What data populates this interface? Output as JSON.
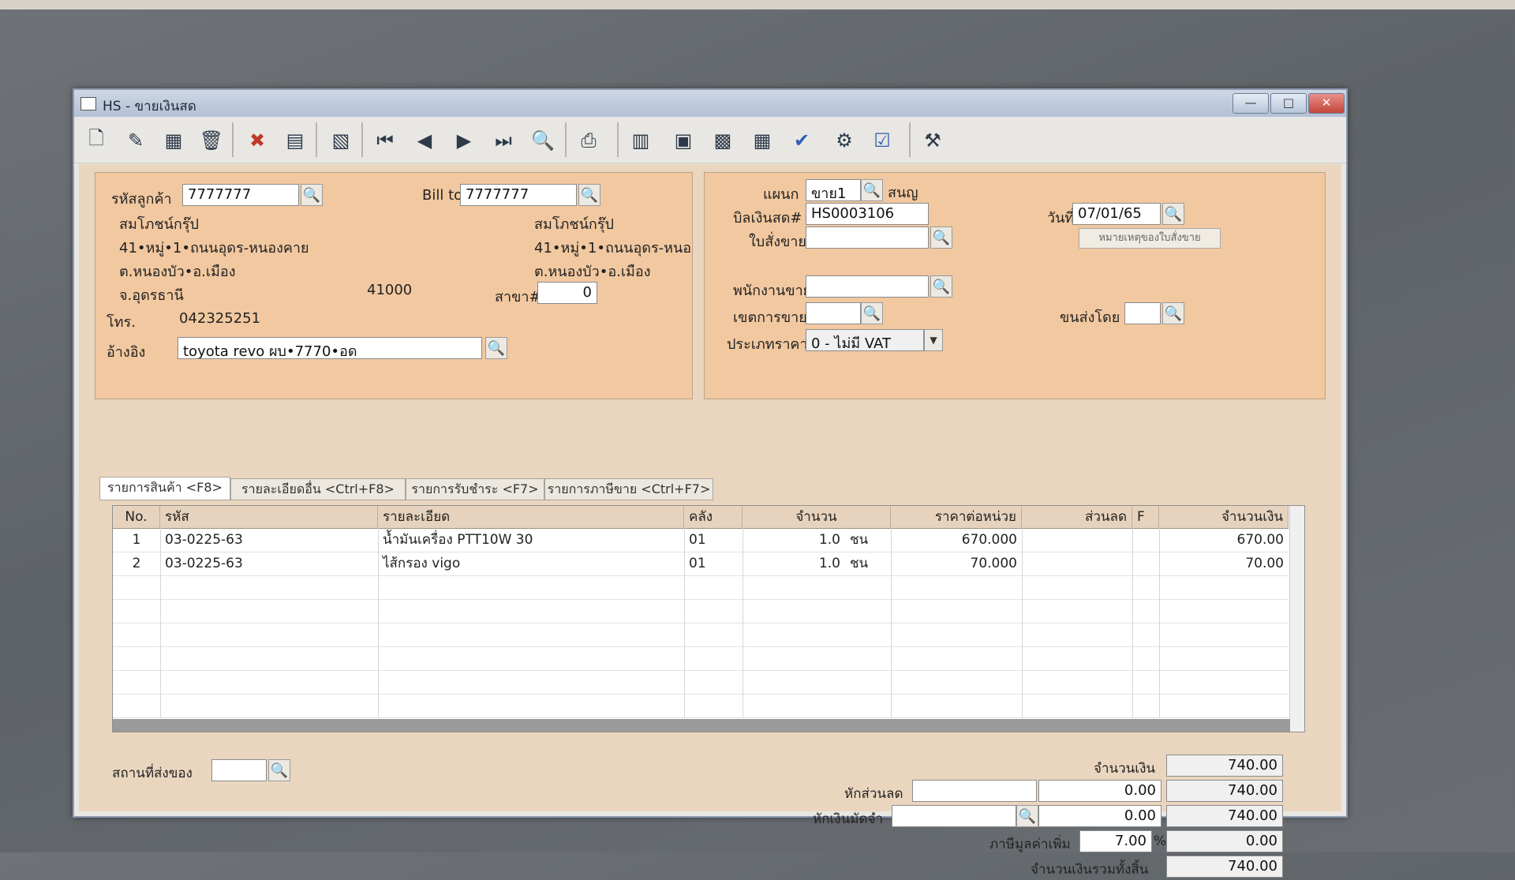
{
  "window": {
    "title": "HS - ขายเงินสด",
    "min": "—",
    "max": "□",
    "close": "✕"
  },
  "toolbar": [
    {
      "name": "new-icon",
      "glyph": "🗋"
    },
    {
      "name": "edit-icon",
      "glyph": "✎"
    },
    {
      "name": "void-icon",
      "glyph": "▦"
    },
    {
      "name": "delete-icon",
      "glyph": "🗑"
    },
    {
      "name": "cancel-icon",
      "glyph": "✖"
    },
    {
      "name": "save-icon",
      "glyph": "▤"
    },
    {
      "name": "copy-icon",
      "glyph": "▧"
    },
    {
      "name": "first-record-icon",
      "glyph": "⏮"
    },
    {
      "name": "prev-record-icon",
      "glyph": "◀"
    },
    {
      "name": "next-record-icon",
      "glyph": "▶"
    },
    {
      "name": "last-record-icon",
      "glyph": "⏭"
    },
    {
      "name": "find-icon",
      "glyph": "🔍"
    },
    {
      "name": "print-icon",
      "glyph": "⎙"
    },
    {
      "name": "report-icon",
      "glyph": "▥"
    },
    {
      "name": "cashbox-icon",
      "glyph": "▣"
    },
    {
      "name": "calculator-icon",
      "glyph": "▩"
    },
    {
      "name": "table-icon",
      "glyph": "▦"
    },
    {
      "name": "approve-icon",
      "glyph": "✔"
    },
    {
      "name": "approve-gear-icon",
      "glyph": "⚙"
    },
    {
      "name": "ok-icon",
      "glyph": "☑"
    },
    {
      "name": "settings-icon",
      "glyph": "⚒"
    }
  ],
  "customer": {
    "code_label": "รหัสลูกค้า",
    "code": "7777777",
    "bill_to_label": "Bill to",
    "bill_to": "7777777",
    "name": "สมโภชน์กรุ๊ป",
    "addr1": "41•หมู่•1•ถนนอุดร-หนองคาย",
    "addr2": "ต.หนองบัว•อ.เมือง",
    "addr3": "จ.อุดรธานี",
    "zip": "41000",
    "billto_name": "สมโภชน์กรุ๊ป",
    "billto_addr1": "41•หมู่•1•ถนนอุดร-หนอ",
    "billto_addr2": "ต.หนองบัว•อ.เมือง",
    "branch_label": "สาขา#",
    "branch": "0",
    "phone_label": "โทร.",
    "phone": "042325251",
    "ref_label": "อ้างอิง",
    "ref": "toyota revo ผบ•7770•อด"
  },
  "doc": {
    "dept_label": "แผนก",
    "dept": "ขาย1",
    "dept_name": "สนญ",
    "bill_label": "บิลเงินสด#",
    "bill": "HS0003106",
    "date_label": "วันที่",
    "date": "07/01/65",
    "so_label": "ใบสั่งขาย",
    "so": "",
    "so_note_button": "หมายเหตุของใบสั่งขาย",
    "sales_label": "พนักงานขาย",
    "sales": "",
    "area_label": "เขตการขาย",
    "area": "",
    "ship_label": "ขนส่งโดย",
    "ship": "",
    "price_type_label": "ประเภทราคา",
    "price_type": "0 - ไม่มี VAT"
  },
  "tabs": [
    "รายการสินค้า <F8>",
    "รายละเอียดอื่น <Ctrl+F8>",
    "รายการรับชำระ <F7>",
    "รายการภาษีขาย <Ctrl+F7>"
  ],
  "grid": {
    "headers": {
      "no": "No.",
      "code": "รหัส",
      "desc": "รายละเอียด",
      "wh": "คลัง",
      "qty": "จำนวน",
      "price": "ราคาต่อหน่วย",
      "disc": "ส่วนลด",
      "f": "F",
      "amount": "จำนวนเงิน"
    },
    "rows": [
      {
        "no": "1",
        "code": "03-0225-63",
        "desc": "น้ำมันเครื่อง PTT10W 30",
        "wh": "01",
        "qty": "1.0",
        "unit": "ชน",
        "price": "670.000",
        "disc": "",
        "f": "",
        "amount": "670.00"
      },
      {
        "no": "2",
        "code": "03-0225-63",
        "desc": "ไส้กรอง vigo",
        "wh": "01",
        "qty": "1.0",
        "unit": "ชน",
        "price": "70.000",
        "disc": "",
        "f": "",
        "amount": "70.00"
      }
    ]
  },
  "footer": {
    "ship_place_label": "สถานที่ส่งของ",
    "ship_place": "",
    "amount_label": "จำนวนเงิน",
    "amount": "740.00",
    "discount_label": "หักส่วนลด",
    "discount_text": "",
    "discount_value": "0.00",
    "after_discount": "740.00",
    "deposit_label": "หักเงินมัดจำ",
    "deposit_text": "",
    "deposit_value": "0.00",
    "after_deposit": "740.00",
    "vat_label": "ภาษีมูลค่าเพิ่ม",
    "vat_rate": "7.00",
    "vat_pct": "%",
    "vat_value": "0.00",
    "total_label": "จำนวนเงินรวมทั้งสิ้น",
    "total": "740.00"
  }
}
